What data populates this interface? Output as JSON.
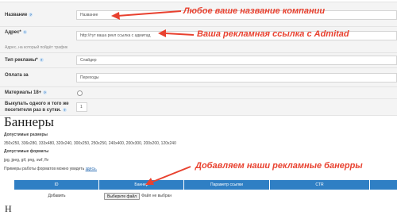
{
  "form": {
    "name": {
      "label": "Название",
      "value": "Название"
    },
    "address": {
      "label": "Адрес*",
      "value": "http://тут ваша рекл ссылка с адмитад",
      "hint": "Адрес, на который пойдёт трафик"
    },
    "ad_type": {
      "label": "Тип рекламы*",
      "value": "Слайдер"
    },
    "payment": {
      "label": "Оплата за",
      "value": "Переходы"
    },
    "adult": {
      "label": "Материалы 18+"
    },
    "show_once": {
      "label_line1": "Выкупать одного и того же",
      "label_line2": "посетителя раз в сутки.",
      "value": "1"
    }
  },
  "banners": {
    "heading": "Баннеры",
    "sizes_title": "Допустимые размеры",
    "sizes": "350x250, 336x280, 333x480, 320x240, 300x250, 250x250, 240x400, 200x300, 200x200, 120x240",
    "formats_title": "Допустимые форматы",
    "formats": "jpg, jpeg, gif, png, swf, flv",
    "examples_text": "Примеры работы форматов можно увидеть",
    "examples_link": "здесь."
  },
  "table": {
    "columns": [
      "ID",
      "Баннер",
      "Параметр ссылки",
      "CTR"
    ],
    "row": {
      "id": "Добавить",
      "file_button": "Выберите файл",
      "file_status": "Файл не выбран"
    }
  },
  "footer_cut": "Н",
  "annotations": {
    "name": "Любое ваше название компании",
    "link": "Ваша рекламная ссылка с Admitad",
    "banners": "Добавляем наши рекламные банерры"
  },
  "colors": {
    "annotation": "#e8412f",
    "table_header": "#2f7fc4",
    "help_icon": "#2a6cb3"
  },
  "icons": [
    "question-help-icon",
    "red-arrow"
  ]
}
